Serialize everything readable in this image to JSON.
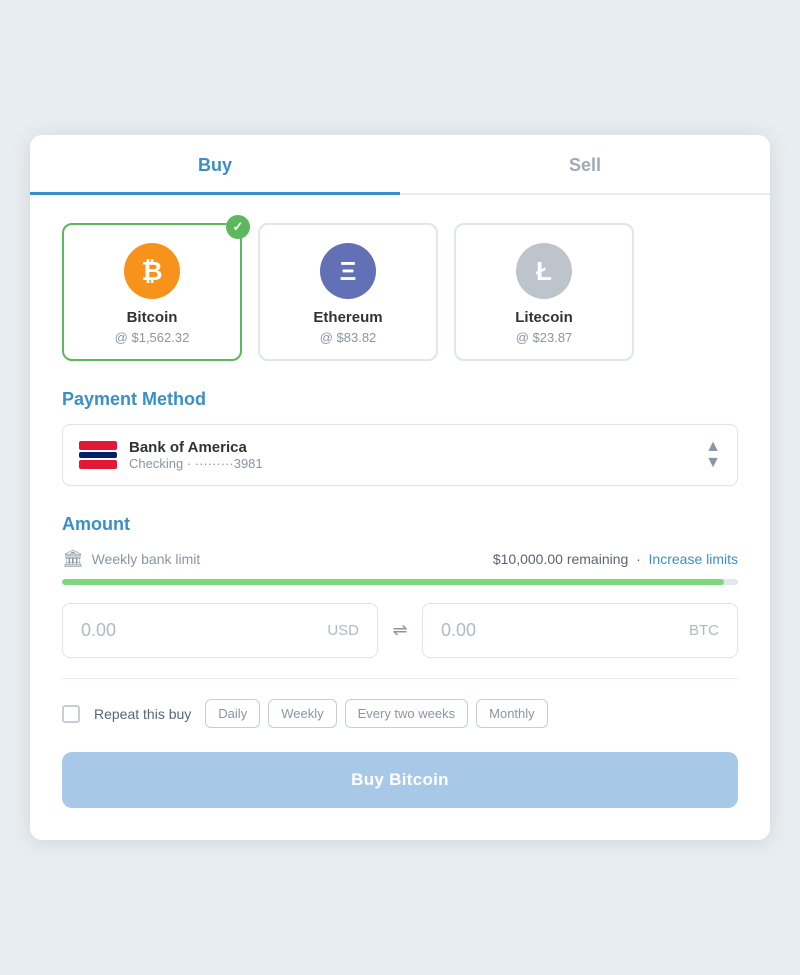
{
  "tabs": {
    "buy": {
      "label": "Buy",
      "active": true
    },
    "sell": {
      "label": "Sell",
      "active": false
    }
  },
  "cryptos": [
    {
      "id": "btc",
      "name": "Bitcoin",
      "price": "@ $1,562.32",
      "selected": true,
      "symbol": "₿",
      "colorClass": "btc"
    },
    {
      "id": "eth",
      "name": "Ethereum",
      "price": "@ $83.82",
      "selected": false,
      "symbol": "Ξ",
      "colorClass": "eth"
    },
    {
      "id": "ltc",
      "name": "Litecoin",
      "price": "@ $23.87",
      "selected": false,
      "symbol": "Ł",
      "colorClass": "ltc"
    }
  ],
  "payment_section": {
    "label": "Payment Method",
    "bank_name": "Bank of America",
    "account_type": "Checking",
    "account_number": "·  ·  ·  ·  ·  ·  ·  ·3981"
  },
  "amount_section": {
    "label": "Amount",
    "limit_label": "Weekly bank limit",
    "remaining": "$10,000.00 remaining",
    "separator": "·",
    "increase_limits": "Increase limits",
    "progress_percent": 98,
    "usd_value": "0.00",
    "usd_currency": "USD",
    "btc_value": "0.00",
    "btc_currency": "BTC"
  },
  "repeat": {
    "label": "Repeat this buy",
    "options": [
      "Daily",
      "Weekly",
      "Every two weeks",
      "Monthly"
    ]
  },
  "buy_button": {
    "label": "Buy Bitcoin"
  }
}
